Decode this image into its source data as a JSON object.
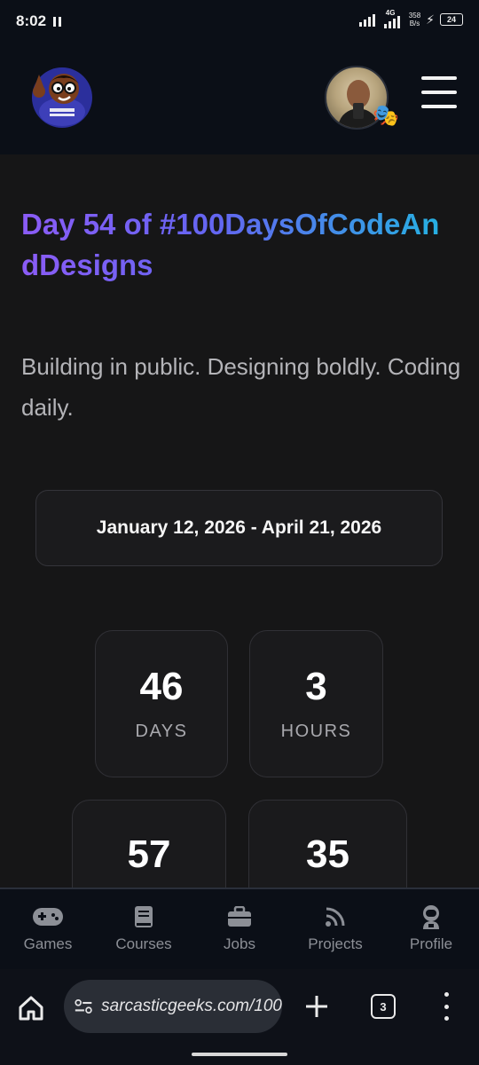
{
  "status_bar": {
    "time": "8:02",
    "network_type": "4G",
    "net_speed_value": "358",
    "net_speed_unit": "B/s",
    "battery": "24"
  },
  "header": {
    "logo_icon": "cartoon-geek-logo",
    "avatar_icon": "user-avatar",
    "badge_icon": "theater-masks-icon",
    "menu_icon": "hamburger-menu-icon"
  },
  "hero": {
    "title": "Day 54 of #100DaysOfCodeAndDesigns",
    "subtitle": "Building in public. Designing boldly. Coding daily."
  },
  "date_range": "January 12, 2026 - April 21, 2026",
  "countdown": {
    "days": {
      "value": "46",
      "label": "DAYS"
    },
    "hours": {
      "value": "3",
      "label": "HOURS"
    },
    "minutes": {
      "value": "57"
    },
    "seconds": {
      "value": "35"
    }
  },
  "bottom_nav": [
    {
      "label": "Games",
      "icon": "gamepad-icon"
    },
    {
      "label": "Courses",
      "icon": "book-icon"
    },
    {
      "label": "Jobs",
      "icon": "briefcase-icon"
    },
    {
      "label": "Projects",
      "icon": "rss-icon"
    },
    {
      "label": "Profile",
      "icon": "user-astronaut-icon"
    }
  ],
  "browser": {
    "url": "sarcasticgeeks.com/100",
    "tab_count": "3"
  },
  "colors": {
    "title_gradient_start": "#8b5cf6",
    "title_gradient_end": "#22b5e0",
    "background": "#161617",
    "header_bg": "#0b0f17"
  }
}
